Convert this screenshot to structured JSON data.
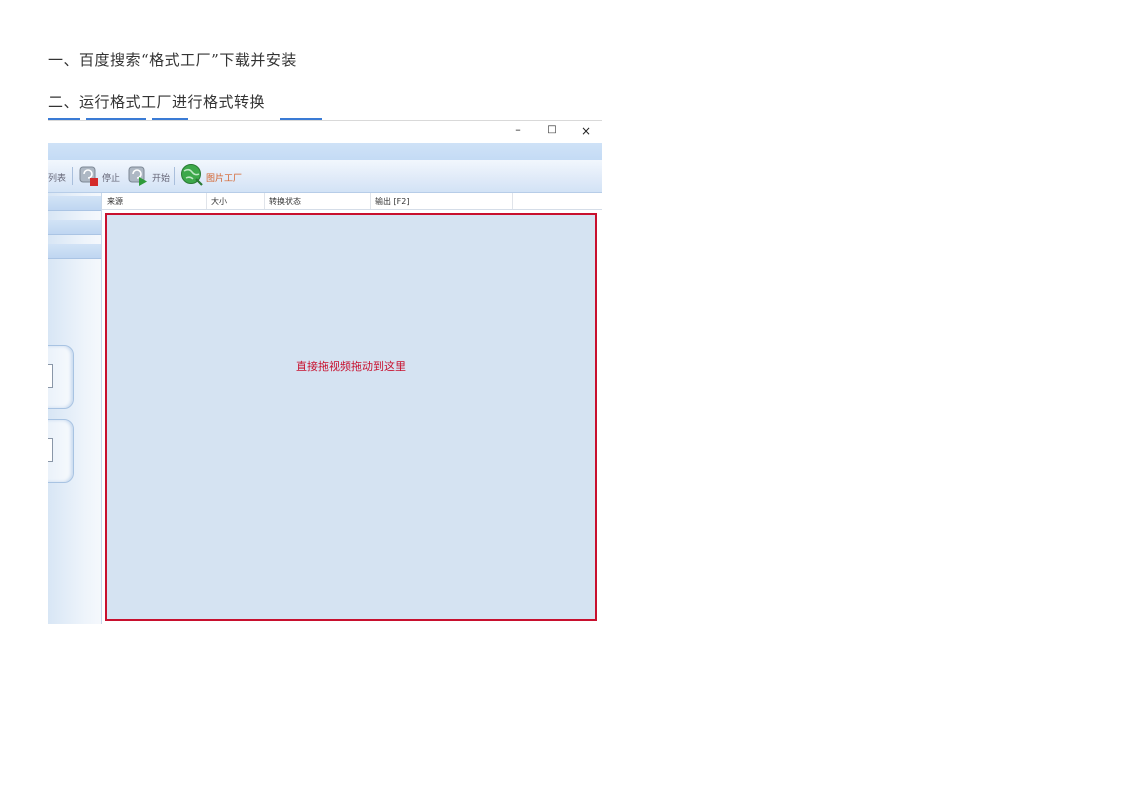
{
  "document": {
    "steps": [
      "一、百度搜索“格式工厂”下载并安装",
      "二、运行格式工厂进行格式转换"
    ]
  },
  "screenshot": {
    "window_controls": {
      "minimize": "–",
      "maximize": "□",
      "close": "×"
    },
    "toolbar": {
      "list_label": "列表",
      "stop_label": "停止",
      "start_label": "开始",
      "factory_label": "图片工厂"
    },
    "table": {
      "columns": [
        "来源",
        "大小",
        "转换状态",
        "输出 [F2]"
      ]
    },
    "dropzone": {
      "hint": "直接拖视频拖动到这里"
    },
    "colors": {
      "accent": "#c8102e",
      "panel": "#d5e3f2",
      "toolbar": "#dfeaf8"
    }
  }
}
